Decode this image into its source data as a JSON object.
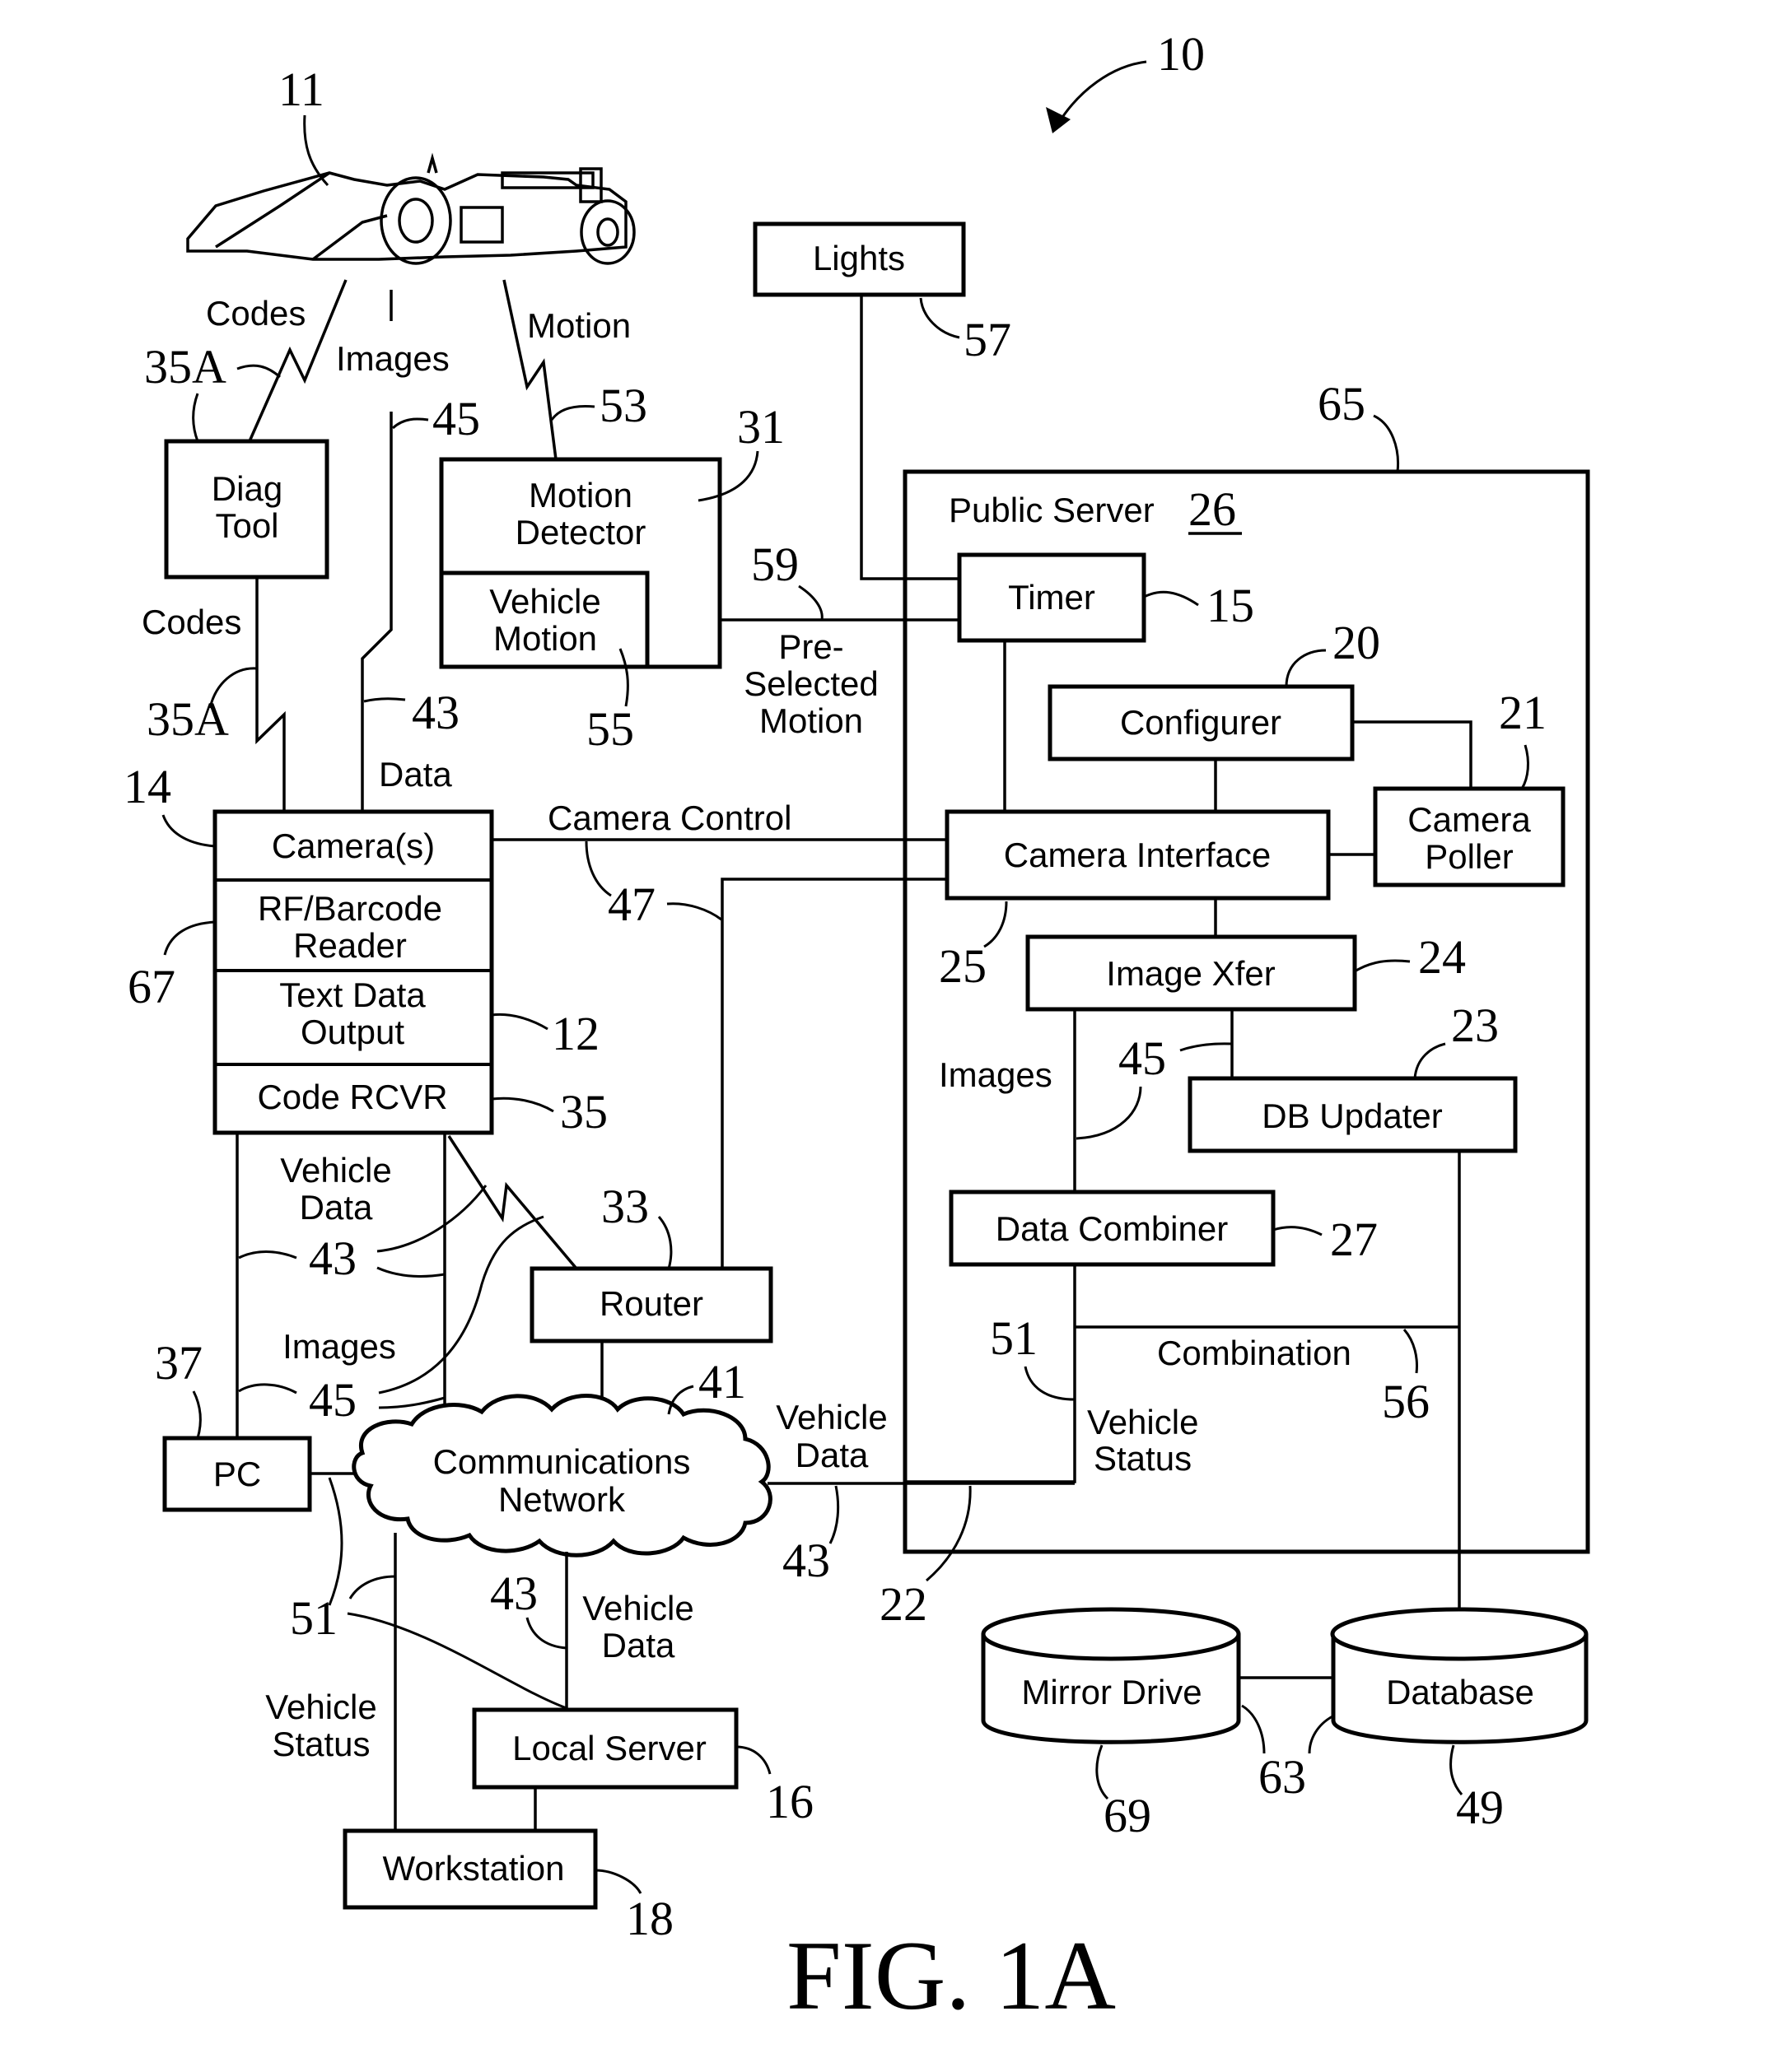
{
  "figure": {
    "title": "FIG. 1A",
    "system_ref": "10"
  },
  "vehicle": {
    "ref": "11",
    "icon": "race-car-icon"
  },
  "blocks": {
    "diag_tool": {
      "line1": "Diag",
      "line2": "Tool"
    },
    "motion_detector": {
      "line1": "Motion",
      "line2": "Detector",
      "ref": "31"
    },
    "vehicle_motion": {
      "line1": "Vehicle",
      "line2": "Motion",
      "ref": "55"
    },
    "lights": {
      "label": "Lights",
      "ref": "57"
    },
    "public_server": {
      "label": "Public Server",
      "ref": "26",
      "outer_ref": "65"
    },
    "timer": {
      "label": "Timer",
      "ref": "15"
    },
    "configurer": {
      "label": "Configurer",
      "ref": "20"
    },
    "camera_poller": {
      "line1": "Camera",
      "line2": "Poller",
      "ref": "21"
    },
    "camera_interface": {
      "label": "Camera Interface",
      "ref": "25"
    },
    "image_xfer": {
      "label": "Image Xfer",
      "ref": "24"
    },
    "db_updater": {
      "label": "DB Updater",
      "ref": "23"
    },
    "data_combiner": {
      "label": "Data Combiner",
      "ref": "27"
    },
    "camera_stack": {
      "ref": "14",
      "cameras": "Camera(s)",
      "rf_line1": "RF/Barcode",
      "rf_line2": "Reader",
      "rf_ref": "67",
      "text_line1": "Text Data",
      "text_line2": "Output",
      "text_ref": "12",
      "code_rcvr": "Code RCVR",
      "code_ref": "35"
    },
    "router": {
      "label": "Router",
      "ref": "33"
    },
    "pc": {
      "label": "PC",
      "ref": "37"
    },
    "network": {
      "line1": "Communications",
      "line2": "Network",
      "ref": "41"
    },
    "local_server": {
      "label": "Local Server",
      "ref": "16"
    },
    "workstation": {
      "label": "Workstation",
      "ref": "18"
    },
    "mirror_drive": {
      "label": "Mirror Drive",
      "ref": "69"
    },
    "database": {
      "label": "Database",
      "ref": "49"
    },
    "db_link_ref": "63"
  },
  "links": {
    "codes_top": "Codes",
    "codes_top_ref": "35A",
    "images_top": "Images",
    "images_top_ref": "45",
    "motion_top": "Motion",
    "motion_top_ref": "53",
    "codes_mid": "Codes",
    "codes_mid_ref": "35A",
    "data_mid": "Data",
    "data_mid_ref": "43",
    "preselected_line1": "Pre-",
    "preselected_line2": "Selected",
    "preselected_line3": "Motion",
    "preselected_ref": "59",
    "camera_control": "Camera Control",
    "camera_control_ref": "47",
    "vehicle_data_left_line1": "Vehicle",
    "vehicle_data_left_line2": "Data",
    "vehicle_data_left_ref": "43",
    "images_left": "Images",
    "images_left_ref": "45",
    "vehicle_data_net_line1": "Vehicle",
    "vehicle_data_net_line2": "Data",
    "vehicle_data_net_ref": "43",
    "server_link_ref": "22",
    "images_server": "Images",
    "images_server_ref": "45",
    "combination": "Combination",
    "combination_ref": "56",
    "vehicle_status_server_line1": "Vehicle",
    "vehicle_status_server_line2": "Status",
    "vehicle_status_server_ref": "51",
    "vehicle_status_left_line1": "Vehicle",
    "vehicle_status_left_line2": "Status",
    "vehicle_status_left_ref": "51",
    "vehicle_data_local_line1": "Vehicle",
    "vehicle_data_local_line2": "Data",
    "vehicle_data_local_ref": "43"
  }
}
